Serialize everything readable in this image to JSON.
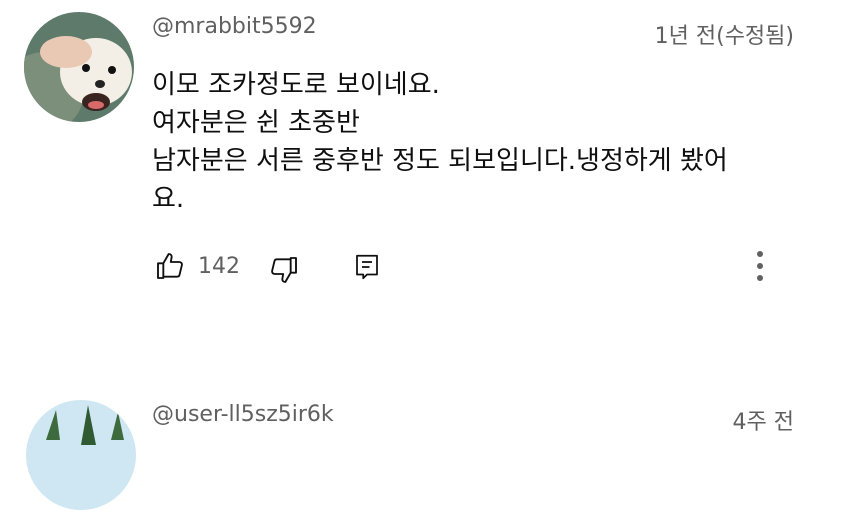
{
  "comments": [
    {
      "author": "@mrabbit5592",
      "time": "1년 전(수정됨)",
      "lines": [
        "이모 조카정도로 보이네요.",
        "여자분은 쉰 초중반",
        "남자분은 서른 중후반 정도 되보입니다.냉정하게 봤어",
        "요."
      ],
      "likes": "142",
      "icons": {
        "like": "thumb-up-icon",
        "dislike": "thumb-down-icon",
        "reply": "reply-icon",
        "more": "more-vertical-icon"
      }
    },
    {
      "author": "@user-ll5sz5ir6k",
      "time": "4주 전"
    }
  ]
}
